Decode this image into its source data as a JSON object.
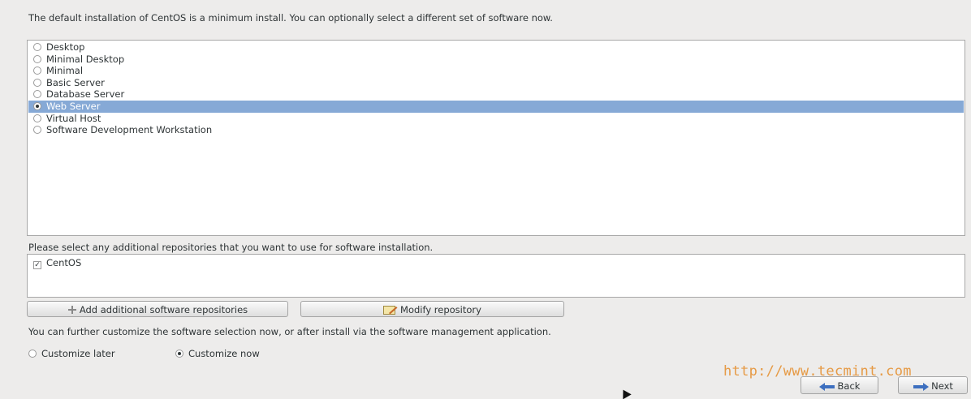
{
  "intro": {
    "text": "The default installation of CentOS is a minimum install. You can optionally select a different set of software now."
  },
  "software_sets": {
    "items": [
      {
        "label": "Desktop",
        "selected": false
      },
      {
        "label": "Minimal Desktop",
        "selected": false
      },
      {
        "label": "Minimal",
        "selected": false
      },
      {
        "label": "Basic Server",
        "selected": false
      },
      {
        "label": "Database Server",
        "selected": false
      },
      {
        "label": "Web Server",
        "selected": true
      },
      {
        "label": "Virtual Host",
        "selected": false
      },
      {
        "label": "Software Development Workstation",
        "selected": false
      }
    ]
  },
  "repositories": {
    "label": "Please select any additional repositories that you want to use for software installation.",
    "items": [
      {
        "label": "CentOS",
        "checked": true
      }
    ]
  },
  "buttons": {
    "add_repo": "Add additional software repositories",
    "modify_repo": "Modify repository",
    "back": "Back",
    "next": "Next"
  },
  "customize": {
    "text": "You can further customize the software selection now, or after install via the software management application.",
    "options": [
      {
        "label": "Customize later",
        "selected": false
      },
      {
        "label": "Customize now",
        "selected": true
      }
    ]
  },
  "watermark": "http://www.tecmint.com",
  "colors": {
    "selection": "#86a9d6",
    "background": "#edeceb",
    "watermark": "#e69a45",
    "arrow_blue": "#3d6fbf"
  },
  "icons": {
    "add_repo": "plus-icon",
    "modify_repo": "edit-icon",
    "back": "arrow-left-icon",
    "next": "arrow-right-icon"
  }
}
